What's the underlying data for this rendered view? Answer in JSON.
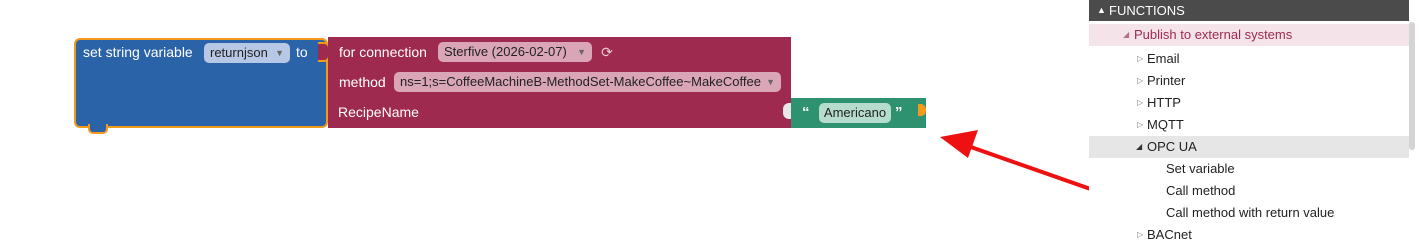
{
  "set_variable_block": {
    "label": "set string variable",
    "variable": "returnjson",
    "to_label": "to"
  },
  "call_method_block": {
    "connection_label": "for connection",
    "connection_value": "Sterfive (2026-02-07)",
    "method_label": "method",
    "method_value": "ns=1;s=CoffeeMachineB-MethodSet-MakeCoffee~MakeCoffee",
    "recipe_label": "RecipeName"
  },
  "text_block": {
    "open_quote": "“",
    "value": "Americano",
    "close_quote": "”"
  },
  "icons": {
    "dropdown": "caret-down-icon",
    "refresh": "refresh-icon",
    "expand": "triangle-down-icon",
    "collapse": "triangle-right-icon"
  },
  "colors": {
    "variable_block": "#2a63a8",
    "selection_outline": "#f39a1c",
    "method_block": "#9e2a4f",
    "text_block": "#2e9271",
    "arrow": "#ee1111",
    "palette_header": "#4b4b4b"
  },
  "palette": {
    "header": "FUNCTIONS",
    "publish": "Publish to external systems",
    "items": {
      "email": "Email",
      "printer": "Printer",
      "http": "HTTP",
      "mqtt": "MQTT",
      "opcua": "OPC UA",
      "set_variable": "Set variable",
      "call_method": "Call method",
      "call_method_return": "Call method with return value",
      "bacnet": "BACnet"
    }
  }
}
